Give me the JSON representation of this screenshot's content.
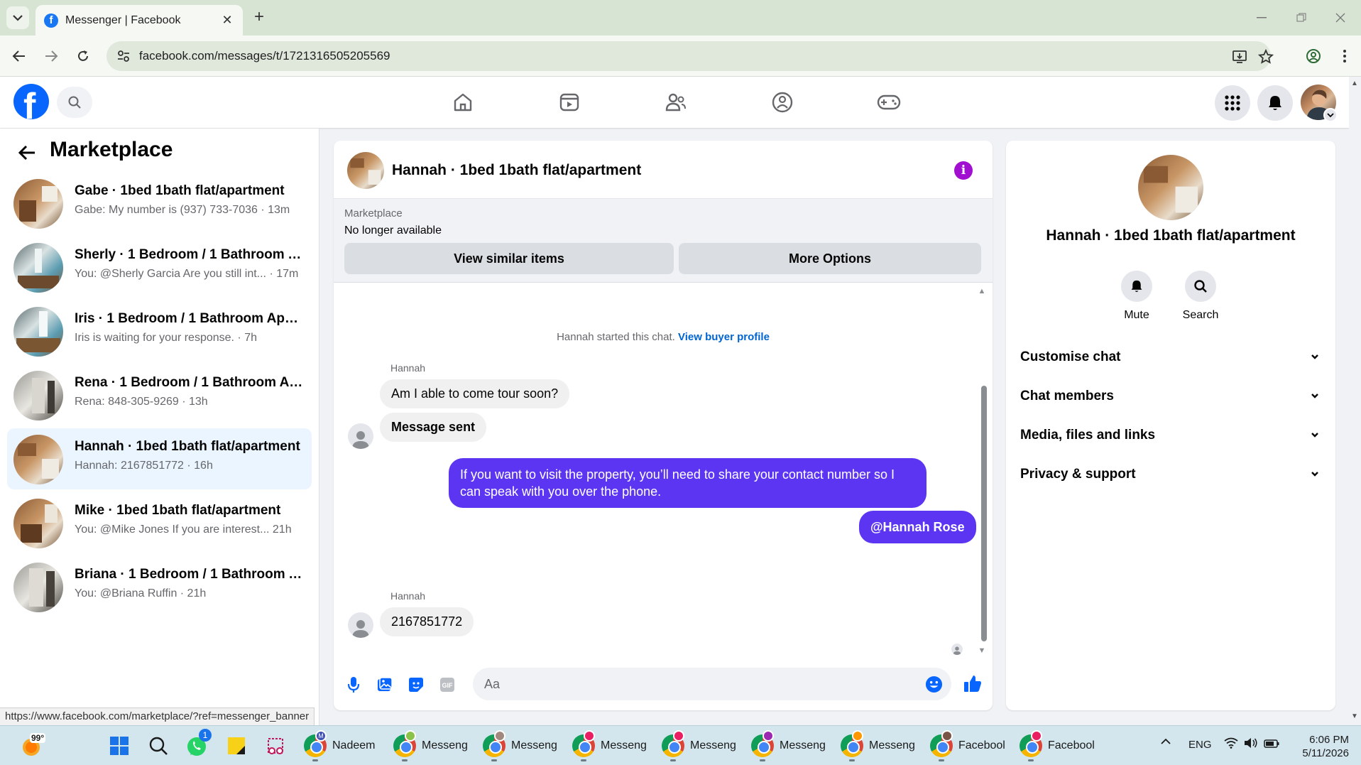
{
  "browser": {
    "tab_title": "Messenger | Facebook",
    "url": "facebook.com/messages/t/1721316505205569",
    "status_url": "https://www.facebook.com/marketplace/?ref=messenger_banner"
  },
  "sidebar": {
    "title": "Marketplace",
    "conversations": [
      {
        "name": "Gabe · 1bed 1bath flat/apartment",
        "snippet": "Gabe: My number is (937) 733-7036 · 13m"
      },
      {
        "name": "Sherly · 1 Bedroom / 1 Bathroom A...",
        "snippet": "You: @Sherly Garcia Are you still int... · 17m"
      },
      {
        "name": "Iris · 1 Bedroom / 1 Bathroom Apar...",
        "snippet": "Iris is waiting for your response. · 7h"
      },
      {
        "name": "Rena · 1 Bedroom / 1 Bathroom Ap...",
        "snippet": "Rena: 848-305-9269 · 13h"
      },
      {
        "name": "Hannah · 1bed 1bath flat/apartment",
        "snippet": "Hannah: 2167851772 · 16h"
      },
      {
        "name": "Mike · 1bed 1bath flat/apartment",
        "snippet": "You: @Mike Jones If you are interest...  21h"
      },
      {
        "name": "Briana · 1 Bedroom / 1 Bathroom A...",
        "snippet": "You: @Briana Ruffin · 21h"
      }
    ]
  },
  "chat": {
    "title": "Hannah · 1bed 1bath flat/apartment",
    "marketplace_label": "Marketplace",
    "listing_status": "No longer available",
    "view_similar_label": "View similar items",
    "more_options_label": "More Options",
    "system_text": "Hannah started this chat.",
    "system_link": "View buyer profile",
    "sender_name_1": "Hannah",
    "msg_1": "Am I able to come tour soon?",
    "msg_2": "Message sent",
    "msg_out_1": "If you want to visit the property, you’ll need to share your contact number so I can speak with you over the phone.",
    "msg_out_2": "@Hannah Rose",
    "sender_name_2": "Hannah",
    "msg_3": "2167851772",
    "composer_placeholder": "Aa"
  },
  "info_panel": {
    "title": "Hannah · 1bed 1bath flat/apartment",
    "mute_label": "Mute",
    "search_label": "Search",
    "sections": [
      "Customise chat",
      "Chat members",
      "Media, files and links",
      "Privacy & support"
    ]
  },
  "taskbar": {
    "weather_temp": "99°",
    "whatsapp_badge": "1",
    "apps": [
      "Nadeem",
      "Messeng",
      "Messeng",
      "Messeng",
      "Messeng",
      "Messeng",
      "Messeng",
      "Facebool",
      "Facebool"
    ],
    "profile_badge_letter": "M",
    "language": "ENG",
    "time": "6:06 PM",
    "date": "5/11/2026"
  },
  "colors": {
    "facebook_blue": "#0866ff",
    "outgoing_bubble": "#5b35f2",
    "info_button": "#a10fd0",
    "link_blue": "#0064d1",
    "active_conversation": "#ebf5ff"
  }
}
